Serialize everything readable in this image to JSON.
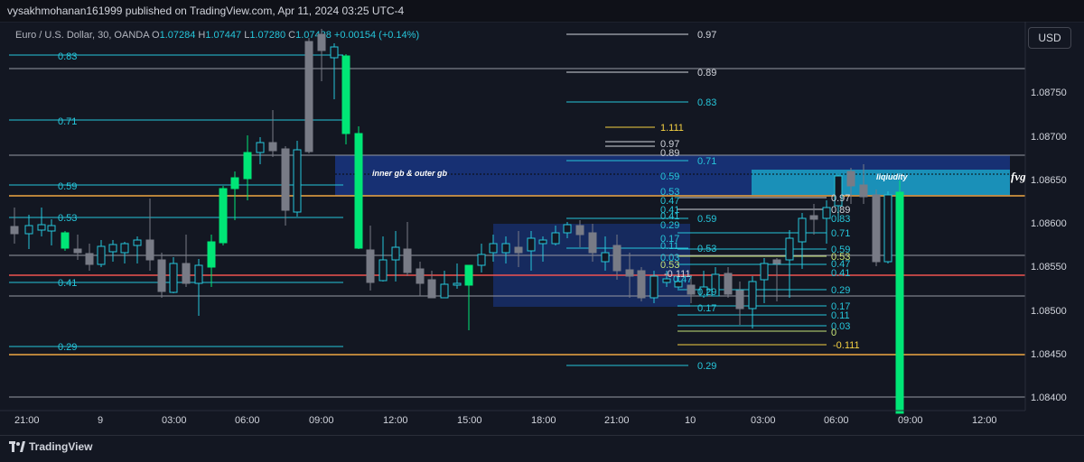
{
  "header": {
    "publish_text": "vysakhmohanan161999 published on TradingView.com, Apr 11, 2024 03:25 UTC-4"
  },
  "legend": {
    "symbol": "Euro / U.S. Dollar, 30, OANDA",
    "o_label": "O",
    "o_value": "1.07284",
    "h_label": "H",
    "h_value": "1.07447",
    "l_label": "L",
    "l_value": "1.07280",
    "c_label": "C",
    "c_value": "1.07438",
    "change": "+0.00154 (+0.14%)"
  },
  "currency": "USD",
  "brand": "TradingView",
  "colors": {
    "background": "#131722",
    "bull": "#00e676",
    "bear": "#787b86",
    "fib": "#26c6da",
    "zone_navy": "#1a3a8f",
    "zone_cyan": "#1ba1c4",
    "orange_line": "#f0a742",
    "red_line": "#ef5350"
  },
  "chart_data": {
    "type": "candlestick",
    "symbol": "EURUSD",
    "timeframe": "30",
    "y_axis_ticks": [
      "1.08750",
      "1.08700",
      "1.08650",
      "1.08600",
      "1.08550",
      "1.08500",
      "1.08450",
      "1.08400"
    ],
    "x_axis_ticks": [
      "21:00",
      "9",
      "03:00",
      "06:00",
      "09:00",
      "12:00",
      "15:00",
      "18:00",
      "21:00",
      "10",
      "03:00",
      "06:00",
      "09:00",
      "12:00"
    ],
    "zone_labels": [
      "inner gb & outer gb",
      "liqiudity",
      "fvg"
    ],
    "fib_left": [
      "0.83",
      "0.71",
      "0.59",
      "0.53",
      "0.41",
      "0.29"
    ],
    "fib_top": [
      "0.97",
      "0.89",
      "0.83",
      "1.111",
      "0.97",
      "0.89",
      "0.71",
      "0.59",
      "0.53",
      "0.47",
      "0.41",
      "0.29",
      "0.17",
      "0.11",
      "0.03",
      "0.53",
      "0.47",
      "0.41",
      "0.59",
      "0.53",
      "0.41",
      "0.29",
      "0.17",
      "0.11",
      "0.03",
      "0",
      "-0.111",
      "0.29",
      "-0.111"
    ],
    "fib_right": [
      "0.97",
      "0.89",
      "0.83",
      "0.71",
      "0.59",
      "0.53",
      "0.47",
      "0.41",
      "0.29",
      "0.17",
      "0.11",
      "0.03",
      "0"
    ]
  }
}
